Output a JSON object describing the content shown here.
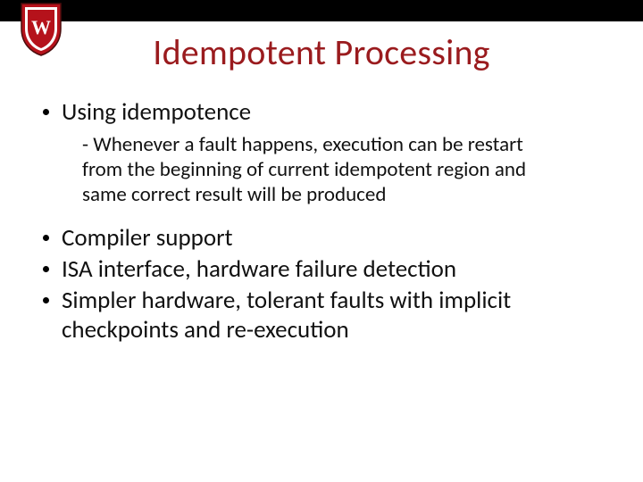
{
  "title": "Idempotent Processing",
  "bullets": {
    "b1": "Using idempotence",
    "sub1": "- Whenever a fault happens, execution can be restart from the beginning of current idempotent region and same correct result will be produced",
    "b2": "Compiler support",
    "b3": "ISA interface, hardware failure detection",
    "b4": "Simpler hardware, tolerant faults with implicit checkpoints and re-execution"
  }
}
